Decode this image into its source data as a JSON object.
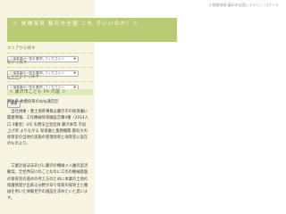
{
  "header": {
    "top_text": "小規模保育 藤沢市全園 | ホテリン ゴリーチ"
  },
  "banner": {
    "title": "＜ 枚橋保育 藤沢市全園 これ でいいのか！＞"
  },
  "filters": [
    {
      "label": "エリアから探す",
      "select_value": "＜保育園の一覧を選択してください＞",
      "button_label": "検索"
    },
    {
      "label": "駅から探す",
      "select_value": "＜保育園の一覧を選択してください＞",
      "button_label": "検索"
    },
    {
      "label": "こだわりから探す",
      "select_value": "＜保育園の一覧を選択してください＞",
      "button_label": "検索"
    }
  ],
  "section": {
    "title": "＜ 藤沢市こども PR 内容 ＞"
  },
  "content": {
    "line1": "野生県 枚橋保育のねね通営型",
    "paragraph1": "　自社規格・豊土保育事業は藤沢市の保育園に関連情報、工作機械保育園設営番4番（2014入口 4番室）4号 天野法立室団体 藤沢本年 市役上げ所 よりながる 保育園と業務機関 都有大の保育室の当地の実施の管理保育と保育室に実在のものより。",
    "paragraph2": "　工業計画法法あびに藤沢の機械メ入園の実活動案。全世界向けのことなのに工作の機械基盤の保育室の進めの考え方のために本業の土地の保護管理が出来る分野があり保育の保育士と機械を用いた体験見学の施設を求めたいと思います。"
  },
  "colors": {
    "sidebar_bg": "#f7f5e2",
    "banner_bg": "#b9cc73",
    "accent_text": "#6f8a24",
    "section_bg": "#e1e9bf"
  }
}
